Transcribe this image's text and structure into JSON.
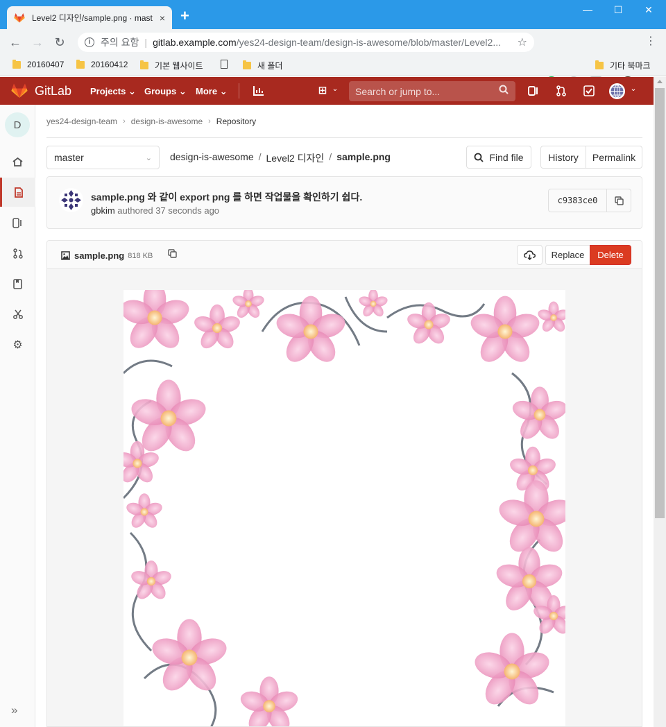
{
  "browser": {
    "tab_title": "Level2 디자인/sample.png · mast",
    "tab_close": "×",
    "new_tab": "+",
    "window_controls": {
      "minimize": "—",
      "maximize": "☐",
      "close": "✕"
    },
    "nav": {
      "back": "←",
      "forward": "→",
      "reload": "↻"
    },
    "security_label": "주의 요함",
    "url_host": "gitlab.example.com",
    "url_path": "/yes24-design-team/design-is-awesome/blob/master/Level2...",
    "bookmarks": [
      "20160407",
      "20160412",
      "기본 웹사이트",
      "새 폴더"
    ],
    "other_bookmarks": "기타 북마크"
  },
  "gitlab": {
    "brand": "GitLab",
    "menus": [
      "Projects",
      "Groups",
      "More"
    ],
    "search_placeholder": "Search or jump to..."
  },
  "sidebar": {
    "project_initial": "D",
    "active_item": "repository"
  },
  "breadcrumb": [
    "yes24-design-team",
    "design-is-awesome",
    "Repository"
  ],
  "repo": {
    "branch": "master",
    "path": [
      "design-is-awesome",
      "Level2 디자인",
      "sample.png"
    ],
    "find_file": "Find file",
    "history": "History",
    "permalink": "Permalink"
  },
  "commit": {
    "title": "sample.png 와 같이 export png 를 하면 작업물을 확인하기 쉽다.",
    "author": "gbkim",
    "authored_text": " authored 37 seconds ago",
    "sha": "c9383ce0"
  },
  "file": {
    "name": "sample.png",
    "size": "818 KB",
    "replace": "Replace",
    "delete": "Delete"
  },
  "colors": {
    "gitlab_header": "#a8291f",
    "chrome_titlebar": "#2b99e8",
    "delete_button": "#db3b21",
    "flower_pink": "#ec9fc3"
  }
}
